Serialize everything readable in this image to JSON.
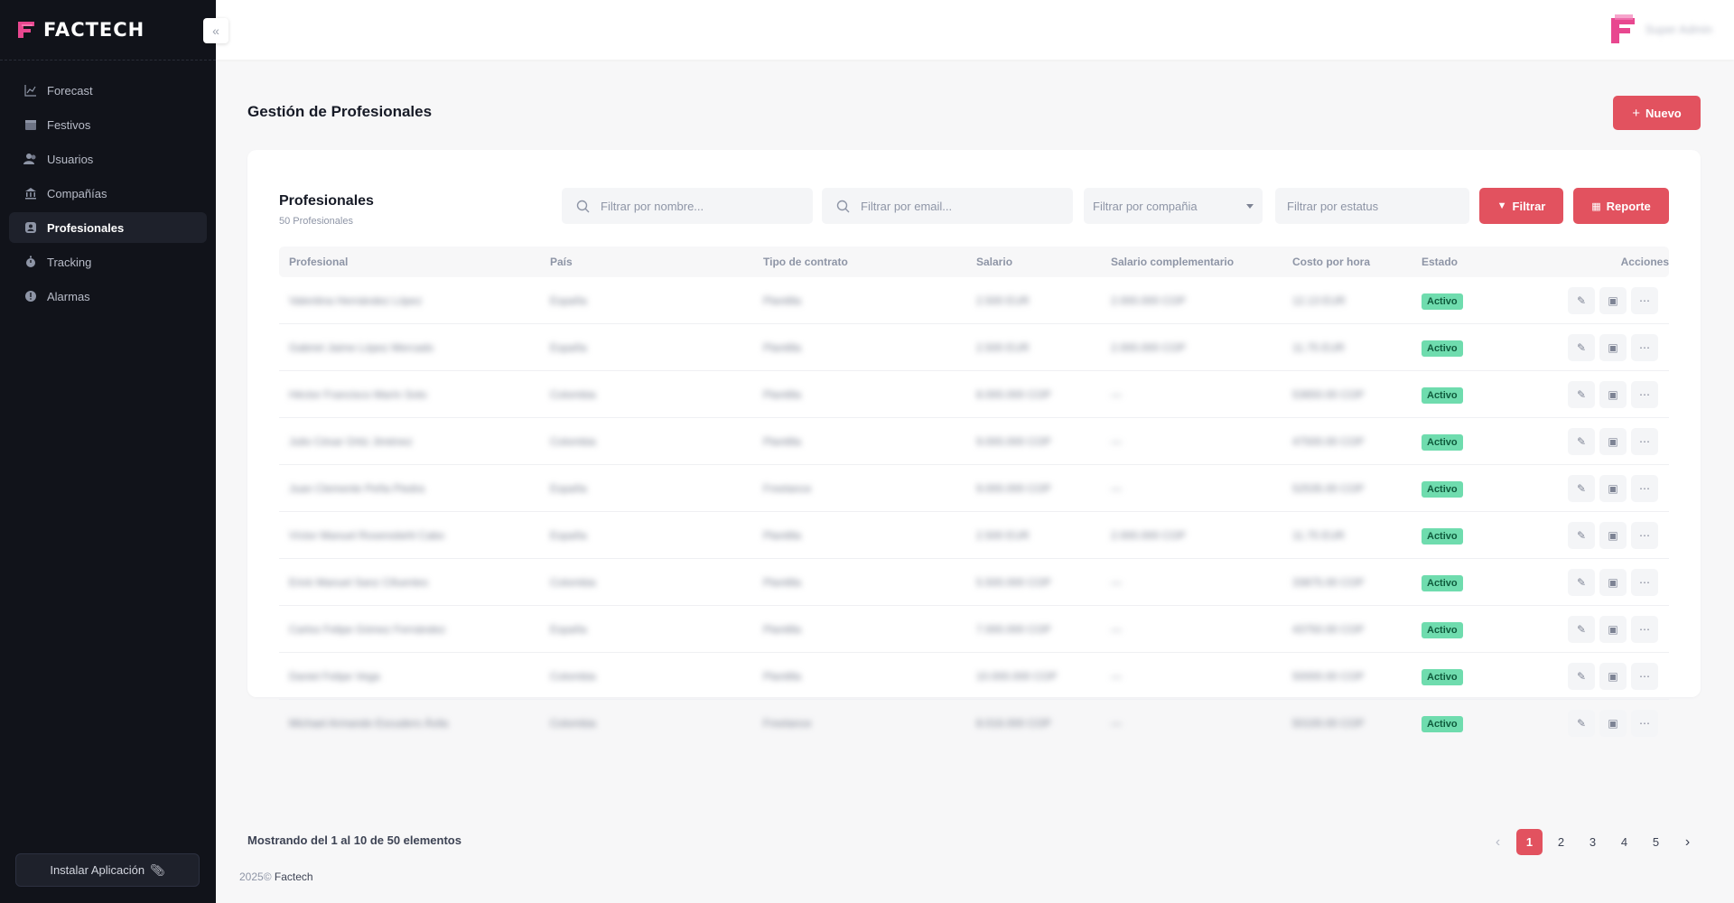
{
  "app": {
    "brand": "FACTECH",
    "user_name": "Super Admin",
    "collapse_icon": "double-chevron-left-icon",
    "install_label": "Instalar Aplicación",
    "footer_year": "2025©",
    "footer_brand": "Factech"
  },
  "sidebar": {
    "items": [
      {
        "label": "Forecast",
        "icon": "chart-line-icon"
      },
      {
        "label": "Festivos",
        "icon": "calendar-icon"
      },
      {
        "label": "Usuarios",
        "icon": "users-icon"
      },
      {
        "label": "Compañías",
        "icon": "bank-icon"
      },
      {
        "label": "Profesionales",
        "icon": "user-badge-icon",
        "active": true
      },
      {
        "label": "Tracking",
        "icon": "stopwatch-icon"
      },
      {
        "label": "Alarmas",
        "icon": "alert-icon"
      }
    ]
  },
  "page": {
    "title": "Gestión de Profesionales",
    "new_button": "Nuevo"
  },
  "card": {
    "title": "Profesionales",
    "subtitle": "50 Profesionales",
    "filter_name_placeholder": "Filtrar por nombre...",
    "filter_email_placeholder": "Filtrar por email...",
    "filter_company": "Filtrar por compañia",
    "filter_status_placeholder": "Filtrar por estatus",
    "filter_button": "Filtrar",
    "report_button": "Reporte"
  },
  "table": {
    "headers": [
      "Profesional",
      "País",
      "Tipo de contrato",
      "Salario",
      "Salario complementario",
      "Costo por hora",
      "Estado",
      "Acciones"
    ],
    "rows": [
      {
        "profesional": "Valentina Hernández López",
        "pais": "España",
        "tipo": "Plantilla",
        "salario": "2.500 EUR",
        "salario_comp": "2.000.000 COP",
        "costo": "12.13 EUR",
        "estado": "Activo"
      },
      {
        "profesional": "Gabriel Jaime López Mercado",
        "pais": "España",
        "tipo": "Plantilla",
        "salario": "2.500 EUR",
        "salario_comp": "2.000.000 COP",
        "costo": "11.75 EUR",
        "estado": "Activo"
      },
      {
        "profesional": "Héctor Francisco Marín Soto",
        "pais": "Colombia",
        "tipo": "Plantilla",
        "salario": "8.000.000 COP",
        "salario_comp": "—",
        "costo": "53650.00 COP",
        "estado": "Activo"
      },
      {
        "profesional": "Julio César Ortiz Jiménez",
        "pais": "Colombia",
        "tipo": "Plantilla",
        "salario": "9.000.000 COP",
        "salario_comp": "—",
        "costo": "47500.00 COP",
        "estado": "Activo"
      },
      {
        "profesional": "Juan Clemente Peña Piedra",
        "pais": "España",
        "tipo": "Freelance",
        "salario": "9.000.000 COP",
        "salario_comp": "—",
        "costo": "52535.00 COP",
        "estado": "Activo"
      },
      {
        "profesional": "Víctor Manuel Rosenstiehl Cabo",
        "pais": "España",
        "tipo": "Plantilla",
        "salario": "2.500 EUR",
        "salario_comp": "2.000.000 COP",
        "costo": "11.75 EUR",
        "estado": "Activo"
      },
      {
        "profesional": "Erick Manuel Sanz Cifuentes",
        "pais": "Colombia",
        "tipo": "Plantilla",
        "salario": "5.500.000 COP",
        "salario_comp": "—",
        "costo": "33875.00 COP",
        "estado": "Activo"
      },
      {
        "profesional": "Carlos Felipe Gómez Fernández",
        "pais": "España",
        "tipo": "Plantilla",
        "salario": "7.000.000 COP",
        "salario_comp": "—",
        "costo": "43750.00 COP",
        "estado": "Activo"
      },
      {
        "profesional": "Daniel Felipe Vega",
        "pais": "Colombia",
        "tipo": "Plantilla",
        "salario": "10.000.000 COP",
        "salario_comp": "—",
        "costo": "50000.00 COP",
        "estado": "Activo"
      },
      {
        "profesional": "Michael Armando Escudero Ávila",
        "pais": "Colombia",
        "tipo": "Freelance",
        "salario": "8.016.000 COP",
        "salario_comp": "—",
        "costo": "50100.00 COP",
        "estado": "Activo"
      }
    ]
  },
  "pagination": {
    "info": "Mostrando del 1 al 10 de 50 elementos",
    "pages": [
      "1",
      "2",
      "3",
      "4",
      "5"
    ],
    "current": "1"
  },
  "colors": {
    "accent": "#e2525f",
    "sidebar_bg": "#11131a",
    "badge_active": "#6fdcae"
  }
}
